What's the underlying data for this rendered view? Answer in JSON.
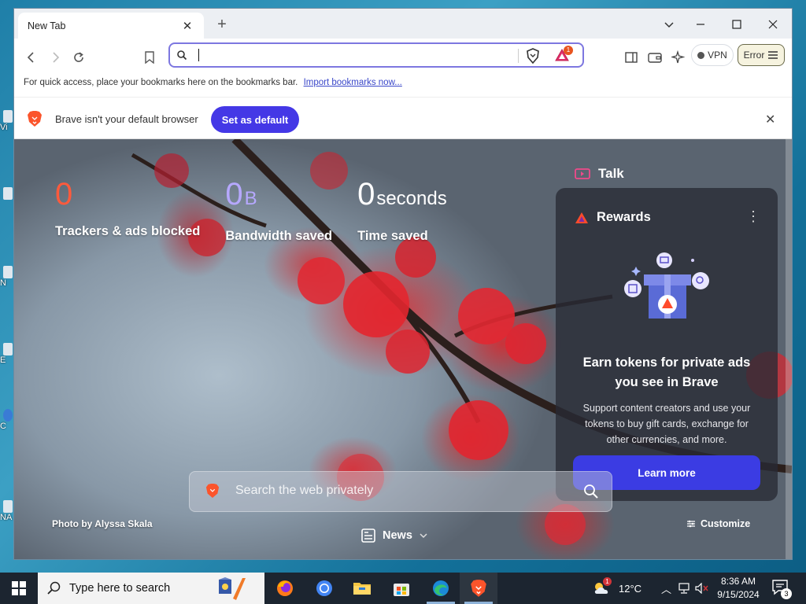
{
  "desktop": {
    "fragments": [
      "Vi",
      "N",
      "E",
      "C",
      "NA"
    ]
  },
  "browser": {
    "tab": {
      "title": "New Tab",
      "close": "✕"
    },
    "toolbar": {
      "address_value": "",
      "rewards_badge": "1",
      "vpn_label": "VPN",
      "error_label": "Error"
    },
    "bookmarks_bar": {
      "text": "For quick access, place your bookmarks here on the bookmarks bar.",
      "import_link": "Import bookmarks now..."
    },
    "infobar": {
      "message": "Brave isn't your default browser",
      "button": "Set as default"
    }
  },
  "newtab": {
    "stats": {
      "trackers_value": "0",
      "trackers_label": "Trackers & ads blocked",
      "bandwidth_value": "0",
      "bandwidth_unit": "B",
      "bandwidth_label": "Bandwidth saved",
      "time_value": "0",
      "time_unit": "seconds",
      "time_label": "Time saved"
    },
    "talk": {
      "label": "Talk"
    },
    "rewards": {
      "header": "Rewards",
      "title": "Earn tokens for private ads you see in Brave",
      "description": "Support content creators and use your tokens to buy gift cards, exchange for other currencies, and more.",
      "button": "Learn more"
    },
    "search": {
      "placeholder": "Search the web privately"
    },
    "photo_credit": "Photo by Alyssa Skala",
    "news_label": "News",
    "customize_label": "Customize"
  },
  "taskbar": {
    "search_placeholder": "Type here to search",
    "weather": "12°C",
    "time": "8:36 AM",
    "date": "9/15/2024",
    "notification_count": "3",
    "weather_badge": "1"
  },
  "colors": {
    "accent": "#4438e6",
    "tracker_orange": "#ff5a3c",
    "bandwidth_purple": "#b6a8ff",
    "taskbar": "#1c2530"
  }
}
